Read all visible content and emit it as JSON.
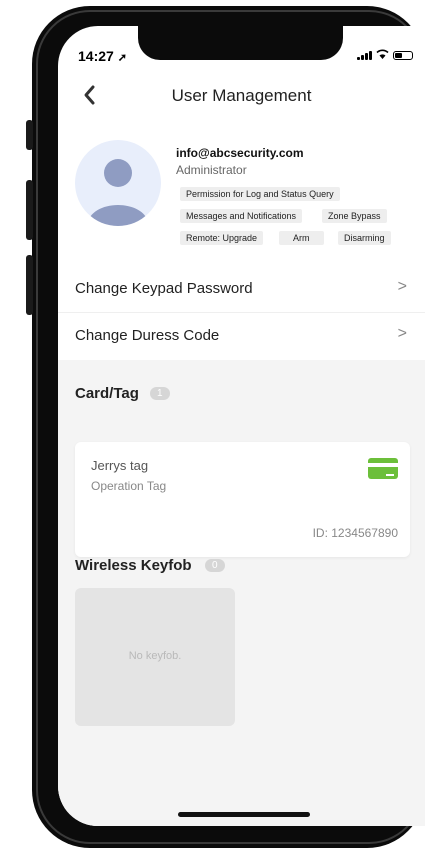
{
  "status": {
    "time": "14:27"
  },
  "header": {
    "title": "User Management"
  },
  "user": {
    "email": "info@abcsecurity.com",
    "role": "Administrator",
    "permissions": [
      "Permission for Log and Status Query",
      "Messages and Notifications",
      "Zone Bypass",
      "Remote: Upgrade",
      "Arm",
      "Disarming"
    ]
  },
  "menu": [
    {
      "label": "Change Keypad Password",
      "chevron": ">"
    },
    {
      "label": "Change Duress Code",
      "chevron": ">"
    }
  ],
  "card_tag": {
    "title": "Card/Tag",
    "count": "1",
    "items": [
      {
        "name": "Jerrys tag",
        "type": "Operation Tag",
        "id": "ID: 1234567890"
      }
    ]
  },
  "keyfob": {
    "title": "Wireless Keyfob",
    "count": "0",
    "empty": "No keyfob."
  },
  "icons": {
    "back": "chevron-left-icon",
    "card": "card-icon",
    "avatar": "person-icon"
  },
  "colors": {
    "accent": "#6cbf3a",
    "section_bg": "#f4f4f4"
  }
}
